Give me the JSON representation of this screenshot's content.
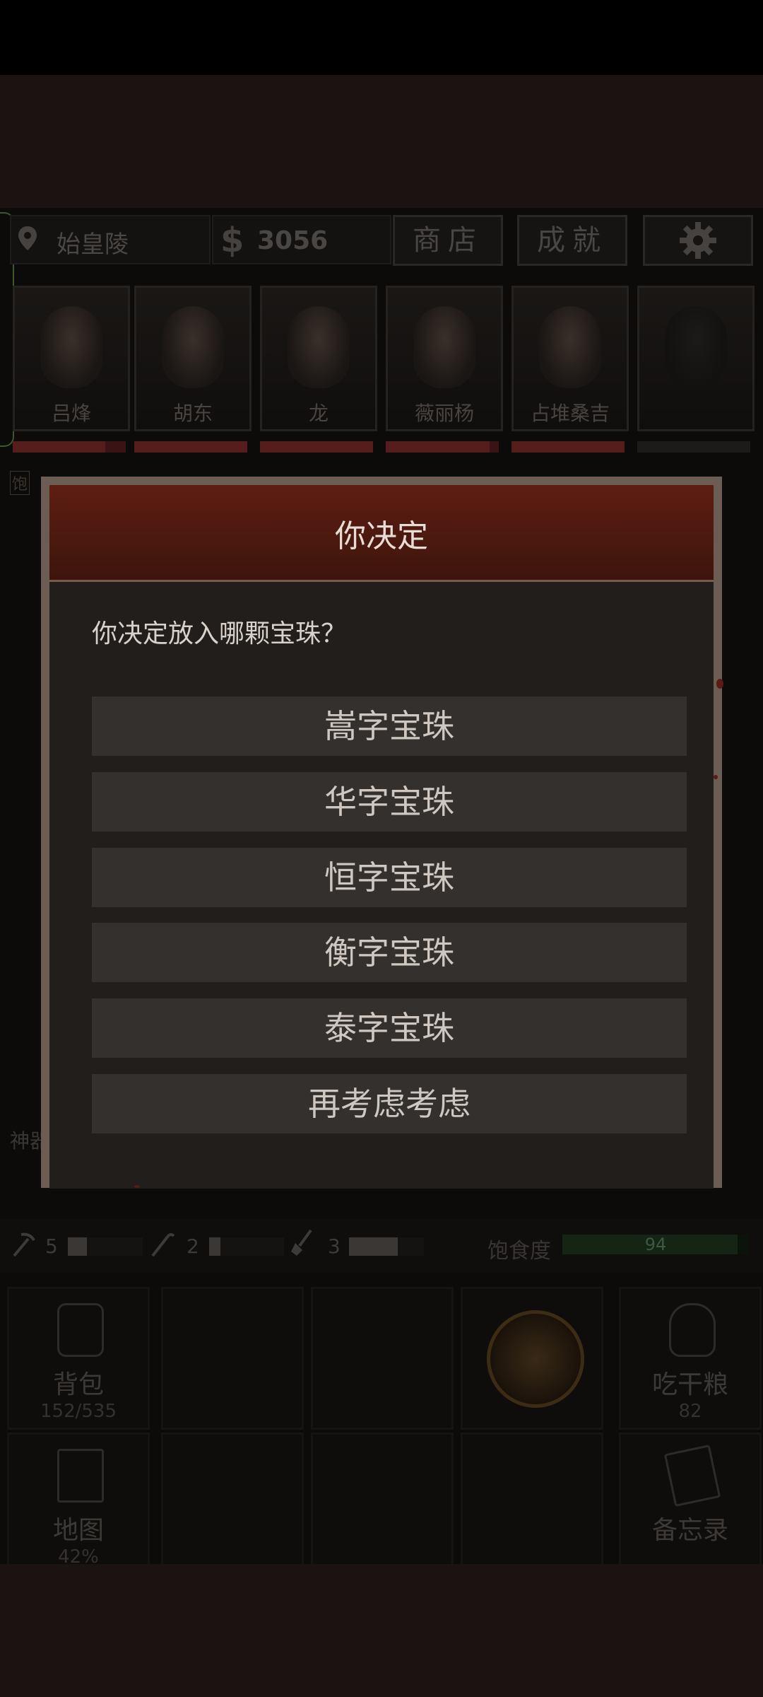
{
  "header": {
    "location": "始皇陵",
    "money": "3056",
    "shop_label": "商店",
    "achievement_label": "成就",
    "dollar_symbol": "$",
    "icons": {
      "location": "map-pin-icon",
      "settings": "gear-icon"
    }
  },
  "party": [
    {
      "name": "吕烽",
      "hp": 0.82
    },
    {
      "name": "胡东",
      "hp": 1.0
    },
    {
      "name": "龙",
      "hp": 1.0
    },
    {
      "name": "薇丽杨",
      "hp": 0.92
    },
    {
      "name": "占堆桑吉",
      "hp": 1.0
    },
    {
      "name": "",
      "hp": 0
    }
  ],
  "status_flag": "饱",
  "side_label": "神器",
  "tools": [
    {
      "icon": "pickaxe-icon",
      "count": "5"
    },
    {
      "icon": "crowbar-icon",
      "count": "2"
    },
    {
      "icon": "shovel-icon",
      "count": "3"
    }
  ],
  "satiety": {
    "label": "饱食度",
    "value": "94",
    "level": 0.94
  },
  "actions": {
    "backpack": {
      "label": "背包",
      "sub": "152/535"
    },
    "eat": {
      "label": "吃干粮",
      "sub": "82"
    },
    "map": {
      "label": "地图",
      "sub": "42%"
    },
    "memo": {
      "label": "备忘录"
    }
  },
  "dialog": {
    "title": "你决定",
    "prompt": "你决定放入哪颗宝珠？",
    "options": [
      "嵩字宝珠",
      "华字宝珠",
      "恒字宝珠",
      "衡字宝珠",
      "泰字宝珠",
      "再考虑考虑"
    ]
  }
}
